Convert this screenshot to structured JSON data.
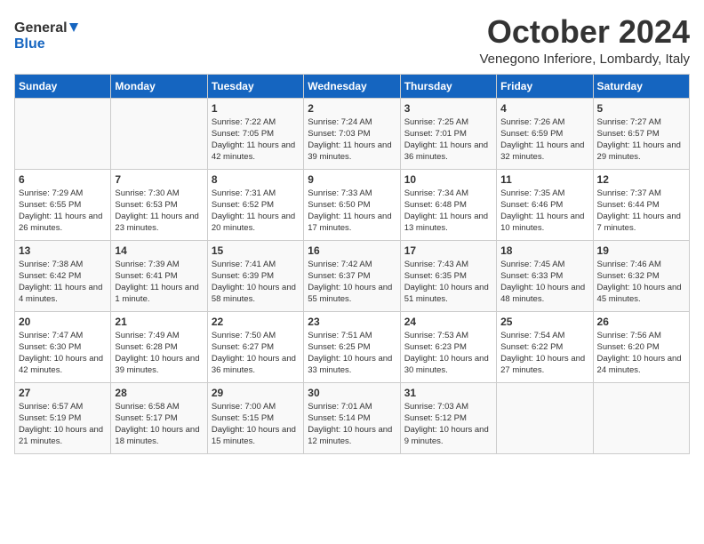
{
  "header": {
    "logo_line1": "General",
    "logo_line2": "Blue",
    "month": "October 2024",
    "location": "Venegono Inferiore, Lombardy, Italy"
  },
  "days_of_week": [
    "Sunday",
    "Monday",
    "Tuesday",
    "Wednesday",
    "Thursday",
    "Friday",
    "Saturday"
  ],
  "weeks": [
    [
      {
        "day": "",
        "info": ""
      },
      {
        "day": "",
        "info": ""
      },
      {
        "day": "1",
        "info": "Sunrise: 7:22 AM\nSunset: 7:05 PM\nDaylight: 11 hours\nand 42 minutes."
      },
      {
        "day": "2",
        "info": "Sunrise: 7:24 AM\nSunset: 7:03 PM\nDaylight: 11 hours\nand 39 minutes."
      },
      {
        "day": "3",
        "info": "Sunrise: 7:25 AM\nSunset: 7:01 PM\nDaylight: 11 hours\nand 36 minutes."
      },
      {
        "day": "4",
        "info": "Sunrise: 7:26 AM\nSunset: 6:59 PM\nDaylight: 11 hours\nand 32 minutes."
      },
      {
        "day": "5",
        "info": "Sunrise: 7:27 AM\nSunset: 6:57 PM\nDaylight: 11 hours\nand 29 minutes."
      }
    ],
    [
      {
        "day": "6",
        "info": "Sunrise: 7:29 AM\nSunset: 6:55 PM\nDaylight: 11 hours\nand 26 minutes."
      },
      {
        "day": "7",
        "info": "Sunrise: 7:30 AM\nSunset: 6:53 PM\nDaylight: 11 hours\nand 23 minutes."
      },
      {
        "day": "8",
        "info": "Sunrise: 7:31 AM\nSunset: 6:52 PM\nDaylight: 11 hours\nand 20 minutes."
      },
      {
        "day": "9",
        "info": "Sunrise: 7:33 AM\nSunset: 6:50 PM\nDaylight: 11 hours\nand 17 minutes."
      },
      {
        "day": "10",
        "info": "Sunrise: 7:34 AM\nSunset: 6:48 PM\nDaylight: 11 hours\nand 13 minutes."
      },
      {
        "day": "11",
        "info": "Sunrise: 7:35 AM\nSunset: 6:46 PM\nDaylight: 11 hours\nand 10 minutes."
      },
      {
        "day": "12",
        "info": "Sunrise: 7:37 AM\nSunset: 6:44 PM\nDaylight: 11 hours\nand 7 minutes."
      }
    ],
    [
      {
        "day": "13",
        "info": "Sunrise: 7:38 AM\nSunset: 6:42 PM\nDaylight: 11 hours\nand 4 minutes."
      },
      {
        "day": "14",
        "info": "Sunrise: 7:39 AM\nSunset: 6:41 PM\nDaylight: 11 hours\nand 1 minute."
      },
      {
        "day": "15",
        "info": "Sunrise: 7:41 AM\nSunset: 6:39 PM\nDaylight: 10 hours\nand 58 minutes."
      },
      {
        "day": "16",
        "info": "Sunrise: 7:42 AM\nSunset: 6:37 PM\nDaylight: 10 hours\nand 55 minutes."
      },
      {
        "day": "17",
        "info": "Sunrise: 7:43 AM\nSunset: 6:35 PM\nDaylight: 10 hours\nand 51 minutes."
      },
      {
        "day": "18",
        "info": "Sunrise: 7:45 AM\nSunset: 6:33 PM\nDaylight: 10 hours\nand 48 minutes."
      },
      {
        "day": "19",
        "info": "Sunrise: 7:46 AM\nSunset: 6:32 PM\nDaylight: 10 hours\nand 45 minutes."
      }
    ],
    [
      {
        "day": "20",
        "info": "Sunrise: 7:47 AM\nSunset: 6:30 PM\nDaylight: 10 hours\nand 42 minutes."
      },
      {
        "day": "21",
        "info": "Sunrise: 7:49 AM\nSunset: 6:28 PM\nDaylight: 10 hours\nand 39 minutes."
      },
      {
        "day": "22",
        "info": "Sunrise: 7:50 AM\nSunset: 6:27 PM\nDaylight: 10 hours\nand 36 minutes."
      },
      {
        "day": "23",
        "info": "Sunrise: 7:51 AM\nSunset: 6:25 PM\nDaylight: 10 hours\nand 33 minutes."
      },
      {
        "day": "24",
        "info": "Sunrise: 7:53 AM\nSunset: 6:23 PM\nDaylight: 10 hours\nand 30 minutes."
      },
      {
        "day": "25",
        "info": "Sunrise: 7:54 AM\nSunset: 6:22 PM\nDaylight: 10 hours\nand 27 minutes."
      },
      {
        "day": "26",
        "info": "Sunrise: 7:56 AM\nSunset: 6:20 PM\nDaylight: 10 hours\nand 24 minutes."
      }
    ],
    [
      {
        "day": "27",
        "info": "Sunrise: 6:57 AM\nSunset: 5:19 PM\nDaylight: 10 hours\nand 21 minutes."
      },
      {
        "day": "28",
        "info": "Sunrise: 6:58 AM\nSunset: 5:17 PM\nDaylight: 10 hours\nand 18 minutes."
      },
      {
        "day": "29",
        "info": "Sunrise: 7:00 AM\nSunset: 5:15 PM\nDaylight: 10 hours\nand 15 minutes."
      },
      {
        "day": "30",
        "info": "Sunrise: 7:01 AM\nSunset: 5:14 PM\nDaylight: 10 hours\nand 12 minutes."
      },
      {
        "day": "31",
        "info": "Sunrise: 7:03 AM\nSunset: 5:12 PM\nDaylight: 10 hours\nand 9 minutes."
      },
      {
        "day": "",
        "info": ""
      },
      {
        "day": "",
        "info": ""
      }
    ]
  ]
}
